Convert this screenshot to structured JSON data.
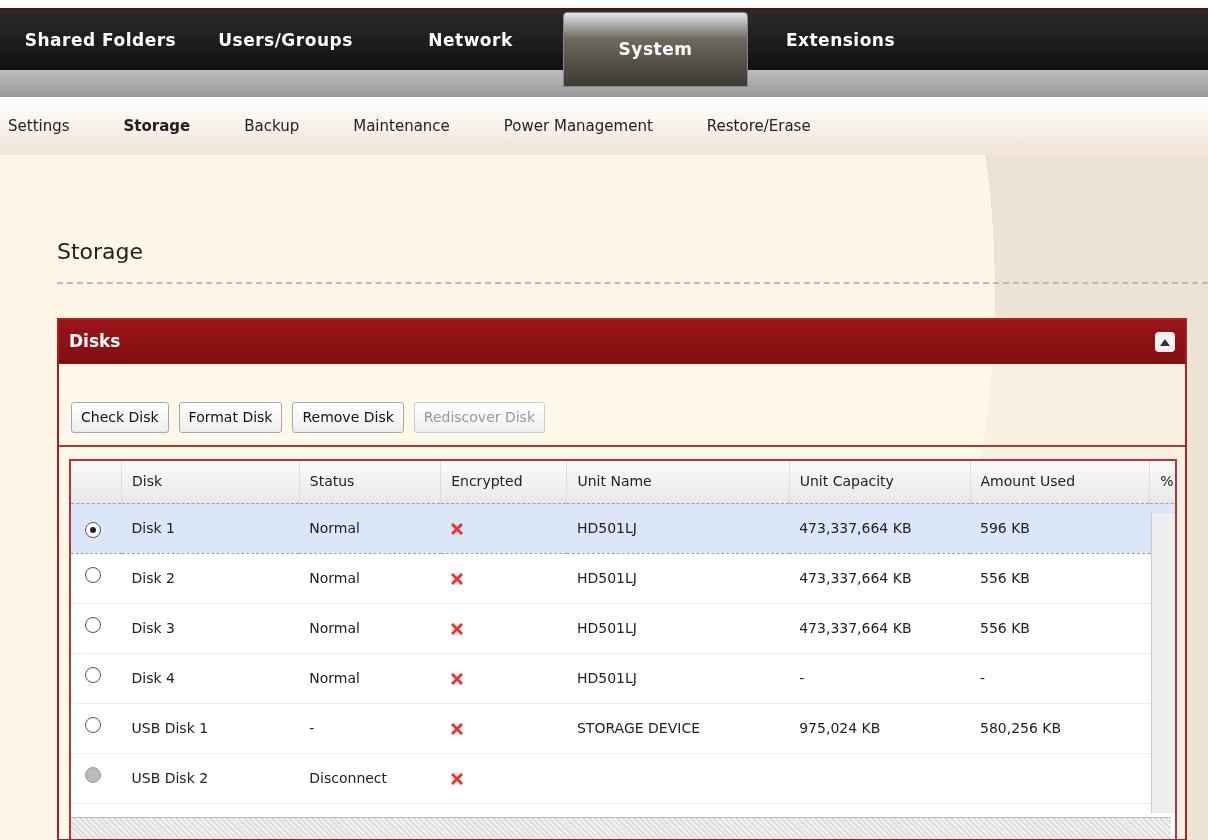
{
  "top_tabs": [
    {
      "label": "Shared Folders",
      "selected": false
    },
    {
      "label": "Users/Groups",
      "selected": false
    },
    {
      "label": "Network",
      "selected": false
    },
    {
      "label": "System",
      "selected": true
    },
    {
      "label": "Extensions",
      "selected": false
    }
  ],
  "sub_tabs": [
    {
      "label": "Settings",
      "selected": false
    },
    {
      "label": "Storage",
      "selected": true
    },
    {
      "label": "Backup",
      "selected": false
    },
    {
      "label": "Maintenance",
      "selected": false
    },
    {
      "label": "Power Management",
      "selected": false
    },
    {
      "label": "Restore/Erase",
      "selected": false
    }
  ],
  "page_title": "Storage",
  "panel": {
    "title": "Disks",
    "expanded": true,
    "buttons": [
      {
        "label": "Check Disk",
        "disabled": false
      },
      {
        "label": "Format Disk",
        "disabled": false
      },
      {
        "label": "Remove Disk",
        "disabled": false
      },
      {
        "label": "Rediscover Disk",
        "disabled": true
      }
    ],
    "table": {
      "columns": [
        "Disk",
        "Status",
        "Encrypted",
        "Unit Name",
        "Unit Capacity",
        "Amount Used",
        "%"
      ],
      "rows": [
        {
          "selected": true,
          "disabled": false,
          "disk": "Disk 1",
          "status": "Normal",
          "encrypted": false,
          "unit_name": "HD501LJ",
          "unit_capacity": "473,337,664 KB",
          "amount_used": "596 KB"
        },
        {
          "selected": false,
          "disabled": false,
          "disk": "Disk 2",
          "status": "Normal",
          "encrypted": false,
          "unit_name": "HD501LJ",
          "unit_capacity": "473,337,664 KB",
          "amount_used": "556 KB"
        },
        {
          "selected": false,
          "disabled": false,
          "disk": "Disk 3",
          "status": "Normal",
          "encrypted": false,
          "unit_name": "HD501LJ",
          "unit_capacity": "473,337,664 KB",
          "amount_used": "556 KB"
        },
        {
          "selected": false,
          "disabled": false,
          "disk": "Disk 4",
          "status": "Normal",
          "encrypted": false,
          "unit_name": "HD501LJ",
          "unit_capacity": "-",
          "amount_used": "-"
        },
        {
          "selected": false,
          "disabled": false,
          "disk": "USB Disk 1",
          "status": "-",
          "encrypted": false,
          "unit_name": "STORAGE DEVICE",
          "unit_capacity": "975,024 KB",
          "amount_used": "580,256 KB"
        },
        {
          "selected": false,
          "disabled": true,
          "disk": "USB Disk 2",
          "status": "Disconnect",
          "encrypted": false,
          "unit_name": "",
          "unit_capacity": "",
          "amount_used": ""
        }
      ]
    }
  }
}
